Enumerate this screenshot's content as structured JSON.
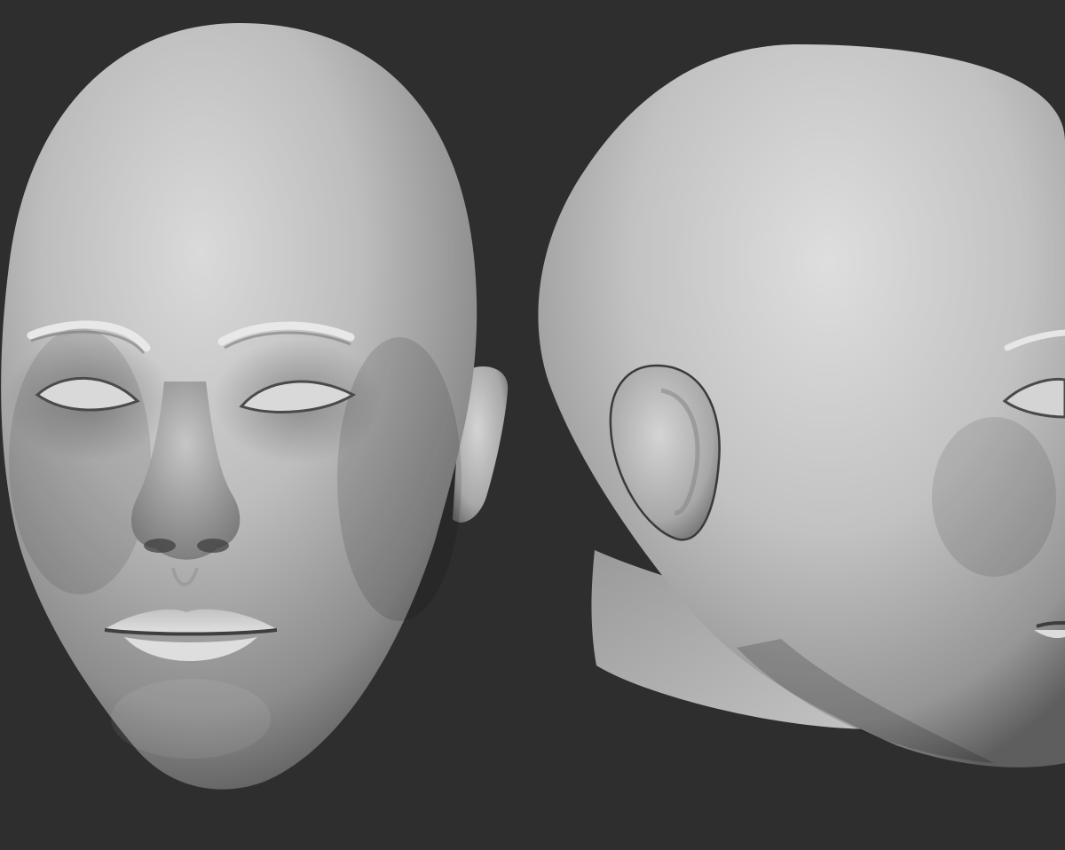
{
  "scene": {
    "background_color": "#2e2e2e",
    "material_color": "#bdbdbd",
    "models": [
      {
        "name": "front-view-head",
        "view": "front"
      },
      {
        "name": "side-view-head",
        "view": "three-quarter-back"
      }
    ]
  }
}
